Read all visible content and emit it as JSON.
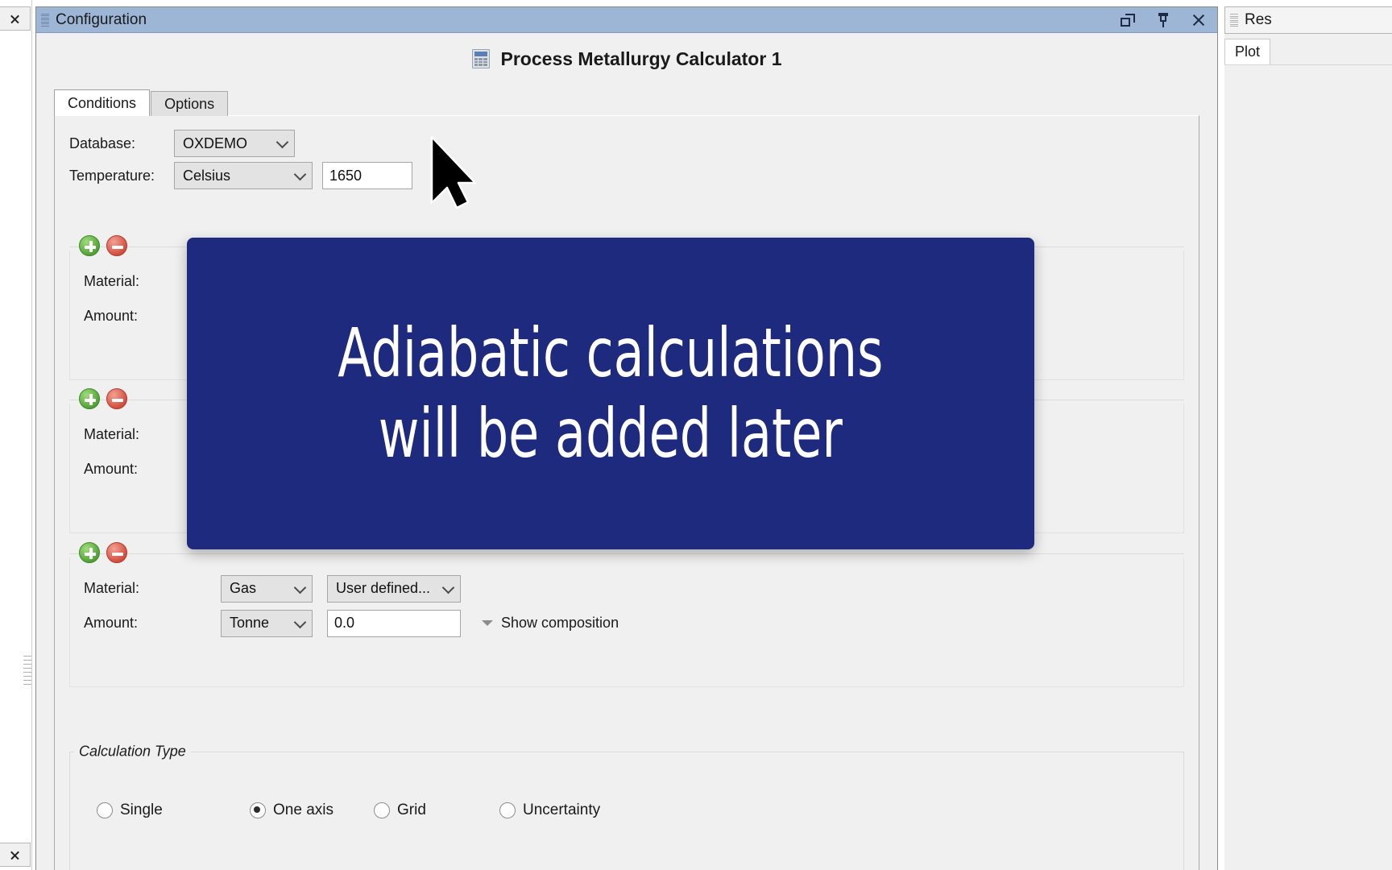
{
  "window": {
    "dock_title": "Configuration",
    "buttons": {
      "float": "float-window",
      "pin": "auto-hide",
      "close": "close"
    }
  },
  "calculator": {
    "title": "Process Metallurgy Calculator 1",
    "icon": "calculator-icon"
  },
  "tabs": [
    {
      "label": "Conditions",
      "active": true
    },
    {
      "label": "Options",
      "active": false
    }
  ],
  "conditions": {
    "database": {
      "label": "Database:",
      "value": "OXDEMO"
    },
    "temperature": {
      "label": "Temperature:",
      "unit": "Celsius",
      "value": "1650"
    },
    "material_groups": [
      {
        "material_label": "Material:",
        "amount_label": "Amount:",
        "material_type": "",
        "material_name": "",
        "amount_unit": "",
        "amount_value": "",
        "show_composition": ""
      },
      {
        "material_label": "Material:",
        "amount_label": "Amount:",
        "material_type": "",
        "material_name": "",
        "amount_unit": "",
        "amount_value": "",
        "show_composition": ""
      },
      {
        "material_label": "Material:",
        "amount_label": "Amount:",
        "material_type": "Gas",
        "material_name": "User defined...",
        "amount_unit": "Tonne",
        "amount_value": "0.0",
        "show_composition": "Show composition"
      }
    ],
    "add_button": "add-material",
    "remove_button": "remove-material"
  },
  "calculation_type": {
    "legend": "Calculation Type",
    "options": [
      {
        "label": "Single",
        "selected": false
      },
      {
        "label": "One axis",
        "selected": true
      },
      {
        "label": "Grid",
        "selected": false
      },
      {
        "label": "Uncertainty",
        "selected": false
      }
    ]
  },
  "results_panel": {
    "title": "Res",
    "tabs": [
      {
        "label": "Plot",
        "active": true
      }
    ]
  },
  "overlay": {
    "text": "Adiabatic calculations\nwill be added later",
    "background": "#1d2a7d",
    "text_color": "#ffffff"
  },
  "colors": {
    "titlebar": "#9db6d6",
    "panel_bg": "#f0f0f0",
    "field_bg": "#ffffff",
    "combo_bg": "#e3e3e3",
    "add_green": "#4e9e34",
    "remove_red": "#cf4a3a"
  }
}
